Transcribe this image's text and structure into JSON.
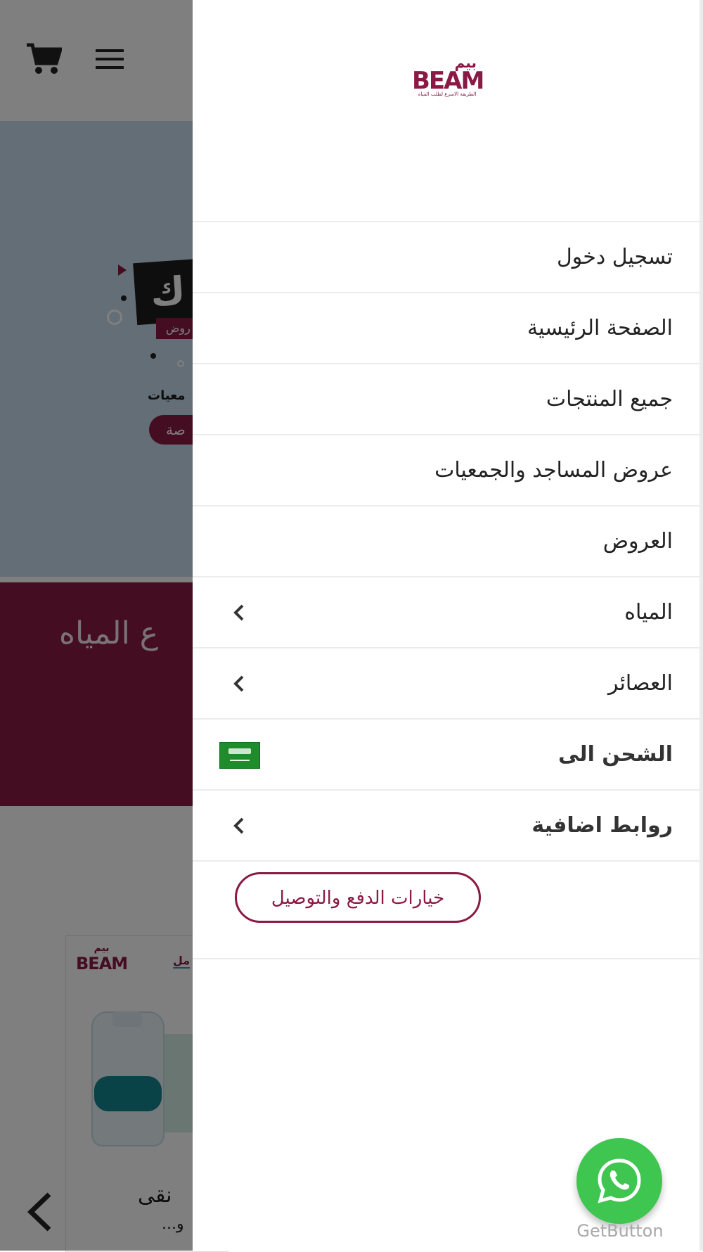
{
  "background_page": {
    "hero": {
      "badge_text": "ك",
      "tag_text": "روض",
      "line_text": "معيات",
      "pill_text": "صة"
    },
    "band": {
      "title": "ع المياه"
    },
    "product": {
      "logo_ar": "بيم",
      "logo_en": "BEAM",
      "tab_label": "مل",
      "name": "نقى",
      "subtitle": "...و"
    }
  },
  "drawer": {
    "logo": {
      "arabic": "بيم",
      "latin": "BEAM",
      "tagline": "الطريقة الاسرع لطلب المياه"
    },
    "menu": [
      {
        "label": "تسجيل دخول",
        "expandable": false
      },
      {
        "label": "الصفحة الرئيسية",
        "expandable": false
      },
      {
        "label": "جميع المنتجات",
        "expandable": false
      },
      {
        "label": "عروض المساجد والجمعيات",
        "expandable": false
      },
      {
        "label": "العروض",
        "expandable": false
      },
      {
        "label": "المياه",
        "expandable": true
      },
      {
        "label": "العصائر",
        "expandable": true
      },
      {
        "label": "الشحن الى",
        "expandable": false,
        "flag": "saudi-arabia-flag"
      },
      {
        "label": "روابط اضافية",
        "expandable": true
      }
    ],
    "cta_label": "خيارات الدفع والتوصيل"
  },
  "whatsapp": {
    "caption": "GetButton"
  },
  "colors": {
    "brand": "#8a1a45",
    "whatsapp": "#3fc651",
    "overlay": "rgba(0,0,0,0.5)",
    "divider": "#ececec"
  }
}
